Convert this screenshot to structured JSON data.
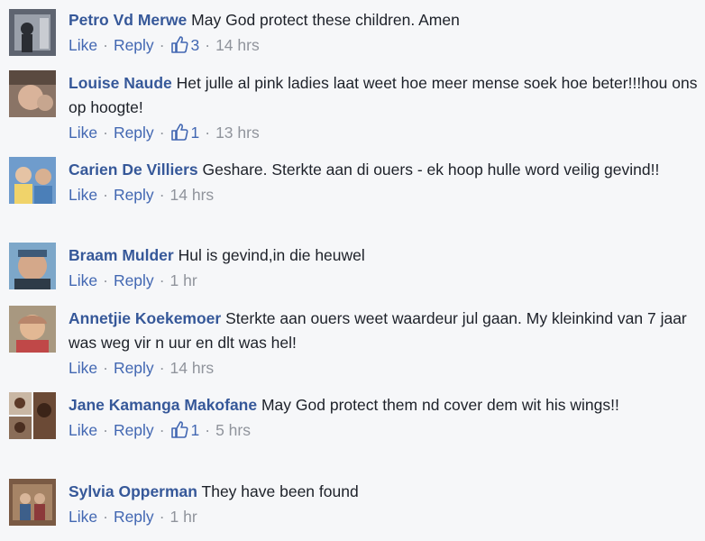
{
  "labels": {
    "like": "Like",
    "reply": "Reply",
    "separator": "·"
  },
  "comments": [
    {
      "author": "Petro Vd Merwe",
      "text": "May God protect these children. Amen",
      "likes": "3",
      "time": "14 hrs"
    },
    {
      "author": "Louise Naude",
      "text": "Het julle al pink ladies laat weet hoe meer mense soek hoe beter!!!hou ons op hoogte!",
      "likes": "1",
      "time": "13 hrs"
    },
    {
      "author": "Carien De Villiers",
      "text": "Geshare. Sterkte aan di ouers - ek hoop hulle word veilig gevind!!",
      "likes": "",
      "time": "14 hrs"
    },
    {
      "author": "Braam Mulder",
      "text": "Hul is gevind,in die heuwel",
      "likes": "",
      "time": "1 hr"
    },
    {
      "author": "Annetjie Koekemoer",
      "text": "Sterkte aan ouers weet waardeur jul gaan. My kleinkind van 7 jaar was weg vir n uur en dlt was hel!",
      "likes": "",
      "time": "14 hrs"
    },
    {
      "author": "Jane Kamanga Makofane",
      "text": "May God protect them nd cover dem wit his wings!!",
      "likes": "1",
      "time": "5 hrs"
    },
    {
      "author": "Sylvia Opperman",
      "text": "They have been found",
      "likes": "",
      "time": "1 hr"
    }
  ]
}
